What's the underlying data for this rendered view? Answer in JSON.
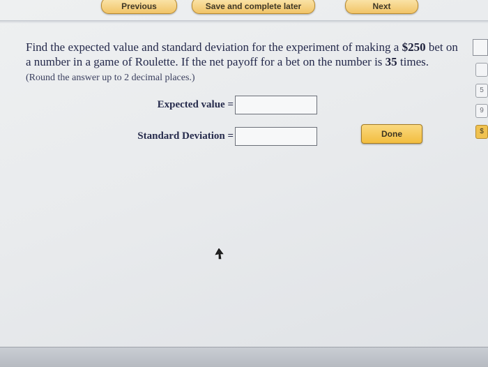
{
  "nav": {
    "previous": "Previous",
    "save": "Save and complete later",
    "next": "Next"
  },
  "question": {
    "line1_pre": "Find the expected value and standard deviation for the experiment of making a ",
    "bet_amount": "$250",
    "line1_post": " bet on a number in a game of Roulette. If the net payoff for a bet on the number is ",
    "payoff": "35",
    "line2_post": " times.",
    "hint": "(Round the answer up to 2 decimal places.)"
  },
  "fields": {
    "expected_value_label": "Expected value =",
    "expected_value": "",
    "std_dev_label": "Standard Deviation =",
    "std_dev": ""
  },
  "done_label": "Done",
  "sidebar_marks": [
    "",
    "5",
    "9",
    "$"
  ],
  "colors": {
    "button_gradient_top": "#fbe7b0",
    "button_gradient_bottom": "#f1c467",
    "done_top": "#fad97f",
    "done_bottom": "#f2bd3f"
  }
}
